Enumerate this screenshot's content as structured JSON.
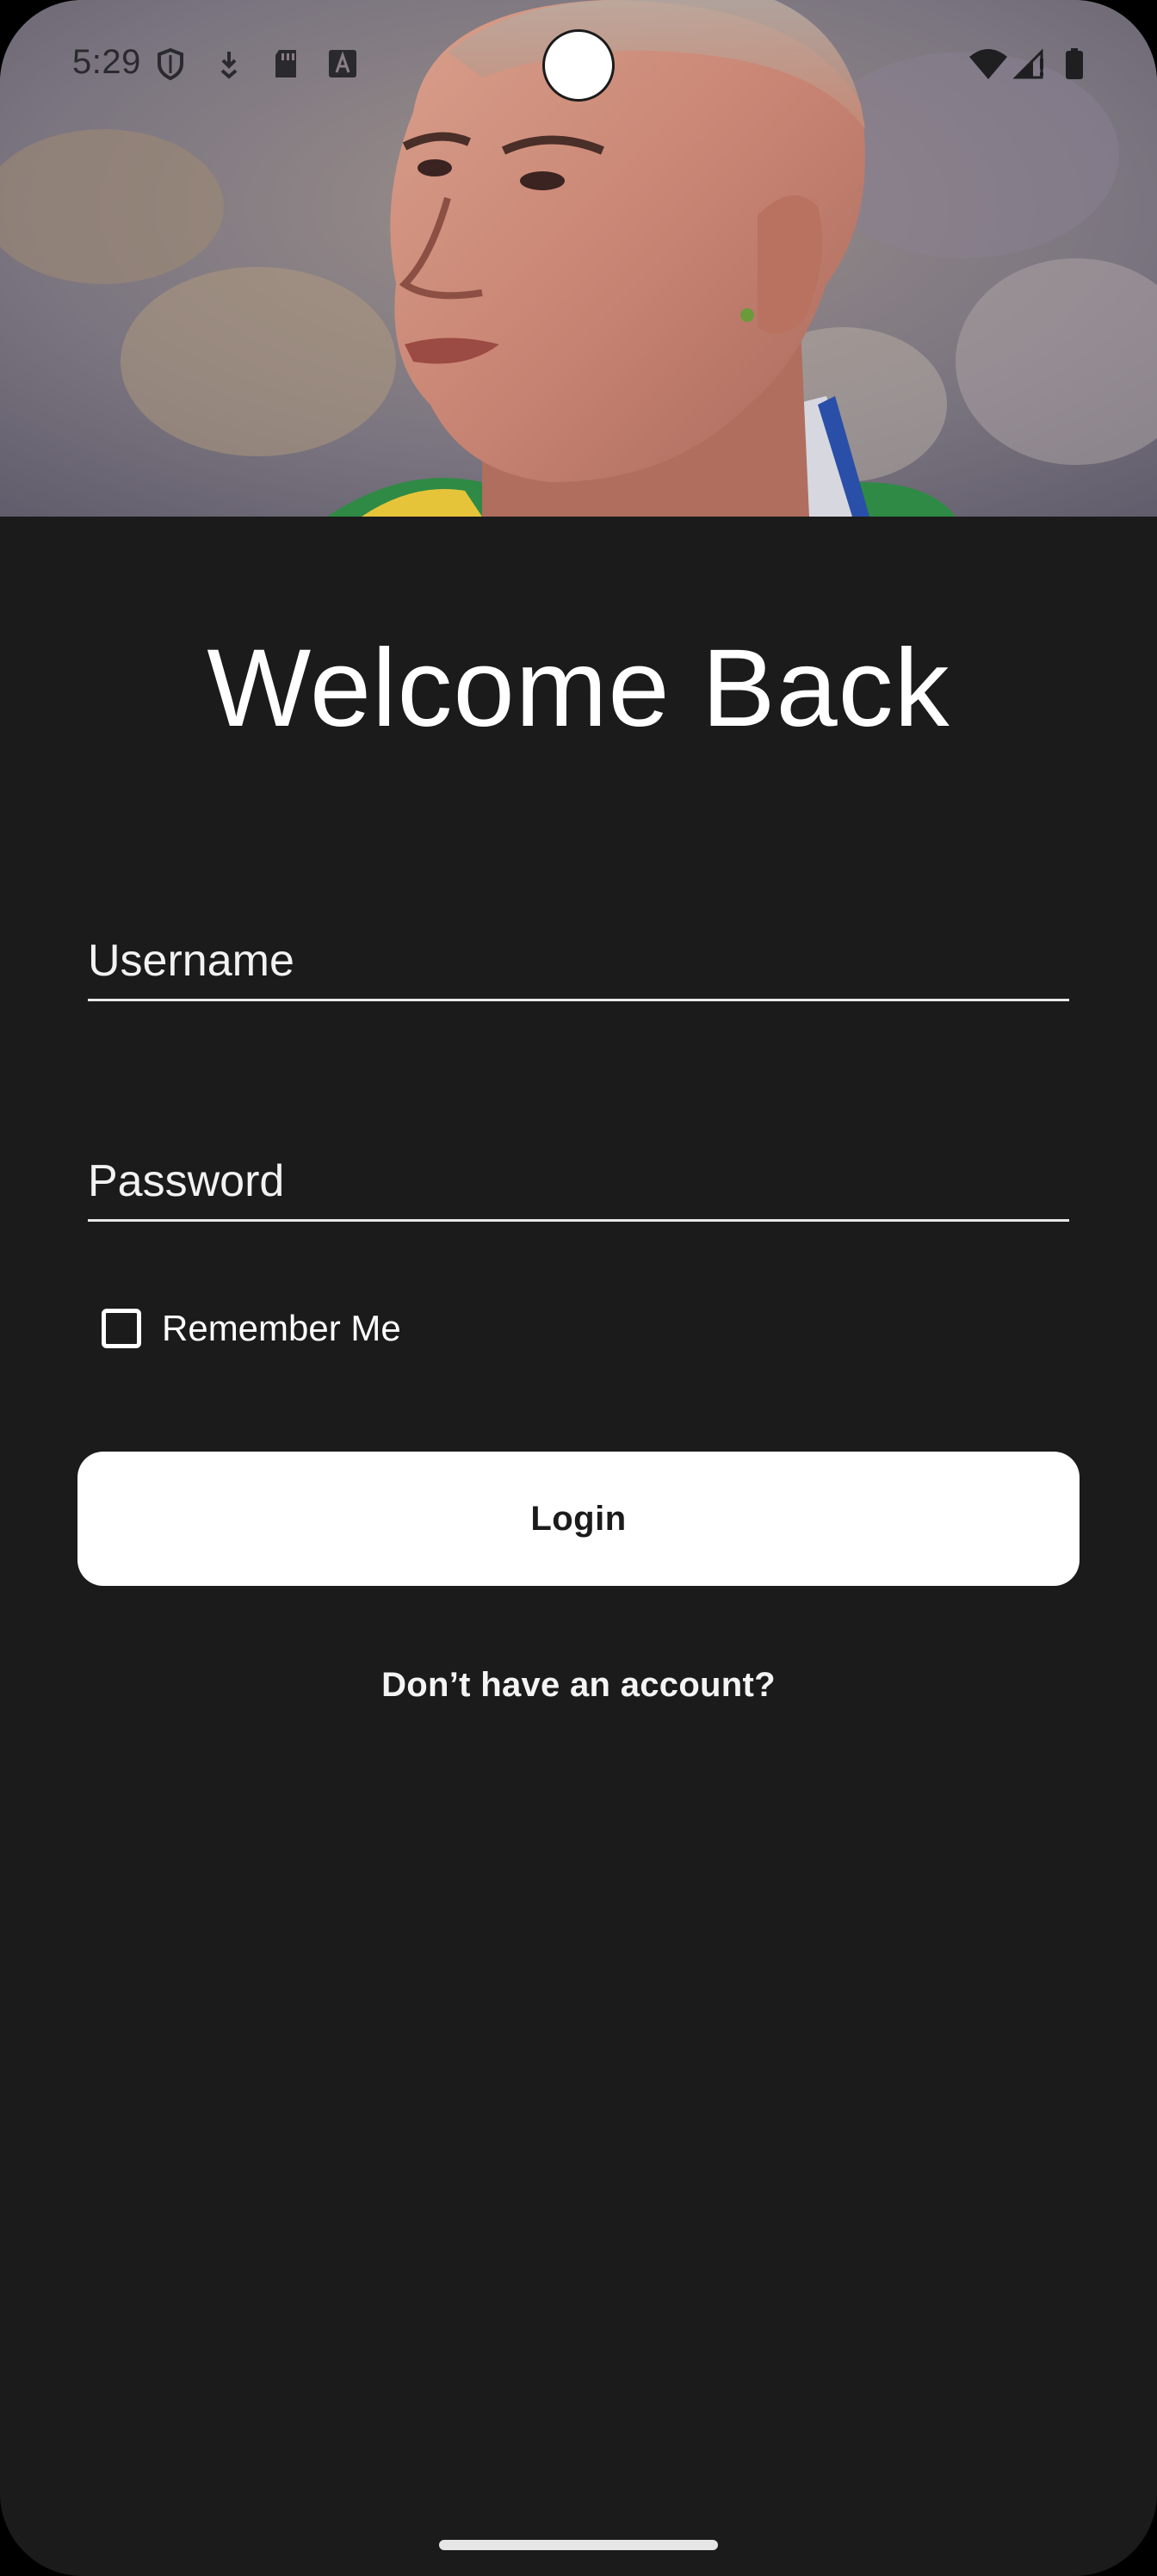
{
  "status_bar": {
    "time": "5:29",
    "left_icons": [
      "shield-icon",
      "download-icon",
      "sd-card-icon",
      "font-a-icon"
    ],
    "right_icons": [
      "wifi-icon",
      "signal-icon",
      "battery-icon"
    ]
  },
  "hero": {
    "image": "footballer-portrait-photo"
  },
  "login": {
    "title": "Welcome Back",
    "username_placeholder": "Username",
    "password_placeholder": "Password",
    "remember_label": "Remember Me",
    "remember_checked": false,
    "login_label": "Login",
    "signup_prompt": "Don’t have an account?"
  },
  "colors": {
    "background": "#1b1b1b",
    "text": "#ffffff",
    "button_bg": "#ffffff",
    "button_text": "#1b1b1b"
  }
}
